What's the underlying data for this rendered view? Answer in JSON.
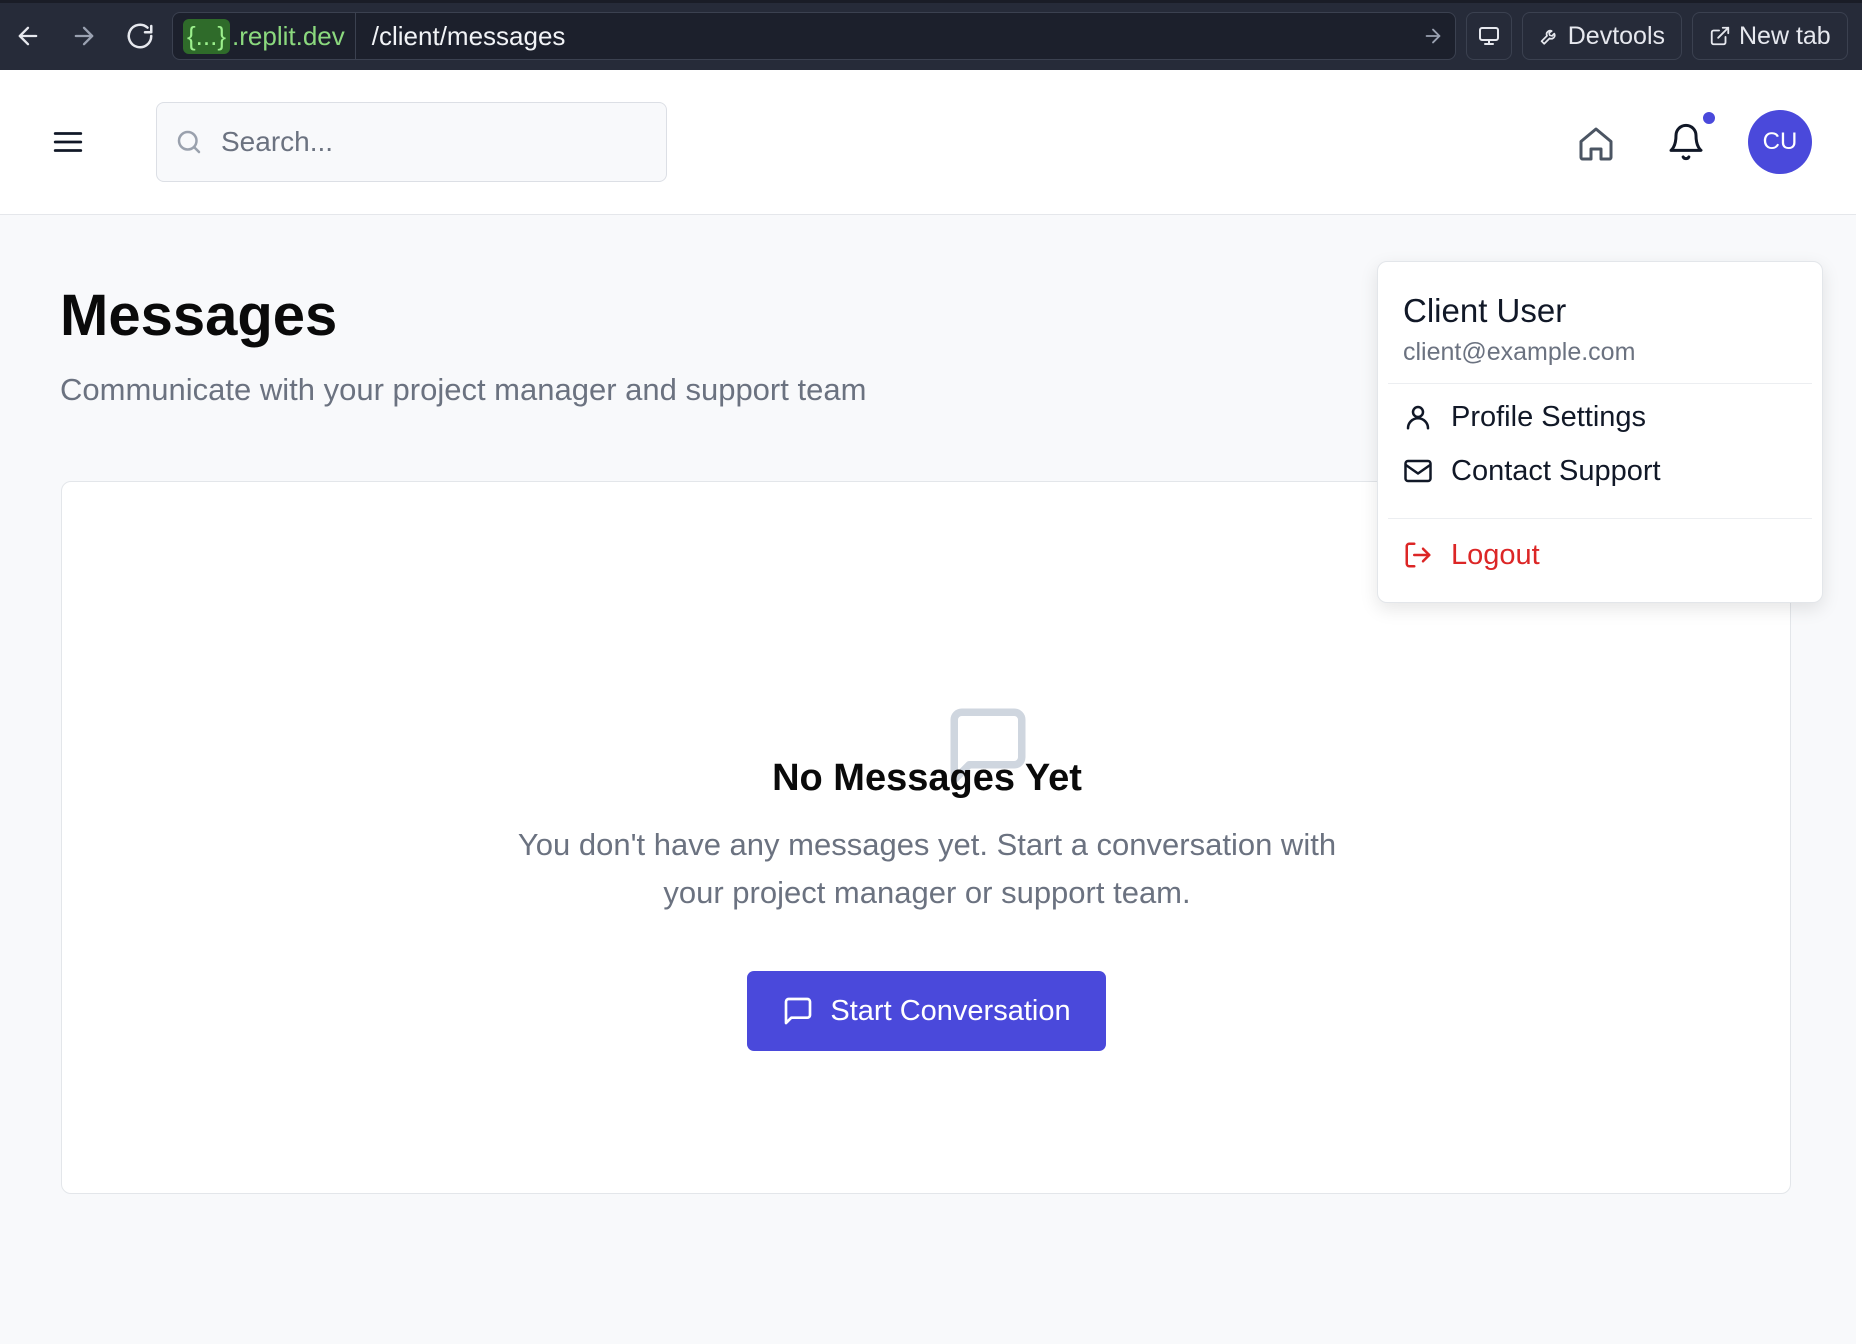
{
  "browser": {
    "url_host_brace": "{...}",
    "url_host_rest": ".replit.dev",
    "url_path": "/client/messages",
    "devtools_label": "Devtools",
    "newtab_label": "New tab"
  },
  "header": {
    "search_placeholder": "Search...",
    "avatar_initials": "CU"
  },
  "page": {
    "title": "Messages",
    "subtitle": "Communicate with your project manager and support team"
  },
  "empty_state": {
    "title": "No Messages Yet",
    "text": "You don't have any messages yet. Start a conversation with your project manager or support team.",
    "button_label": "Start Conversation"
  },
  "user_menu": {
    "name": "Client User",
    "email": "client@example.com",
    "items": [
      {
        "label": "Profile Settings",
        "icon": "user-icon"
      },
      {
        "label": "Contact Support",
        "icon": "mail-icon"
      }
    ],
    "logout_label": "Logout"
  },
  "colors": {
    "accent": "#4a49db",
    "danger": "#dc2626",
    "muted_text": "#6b7280"
  }
}
